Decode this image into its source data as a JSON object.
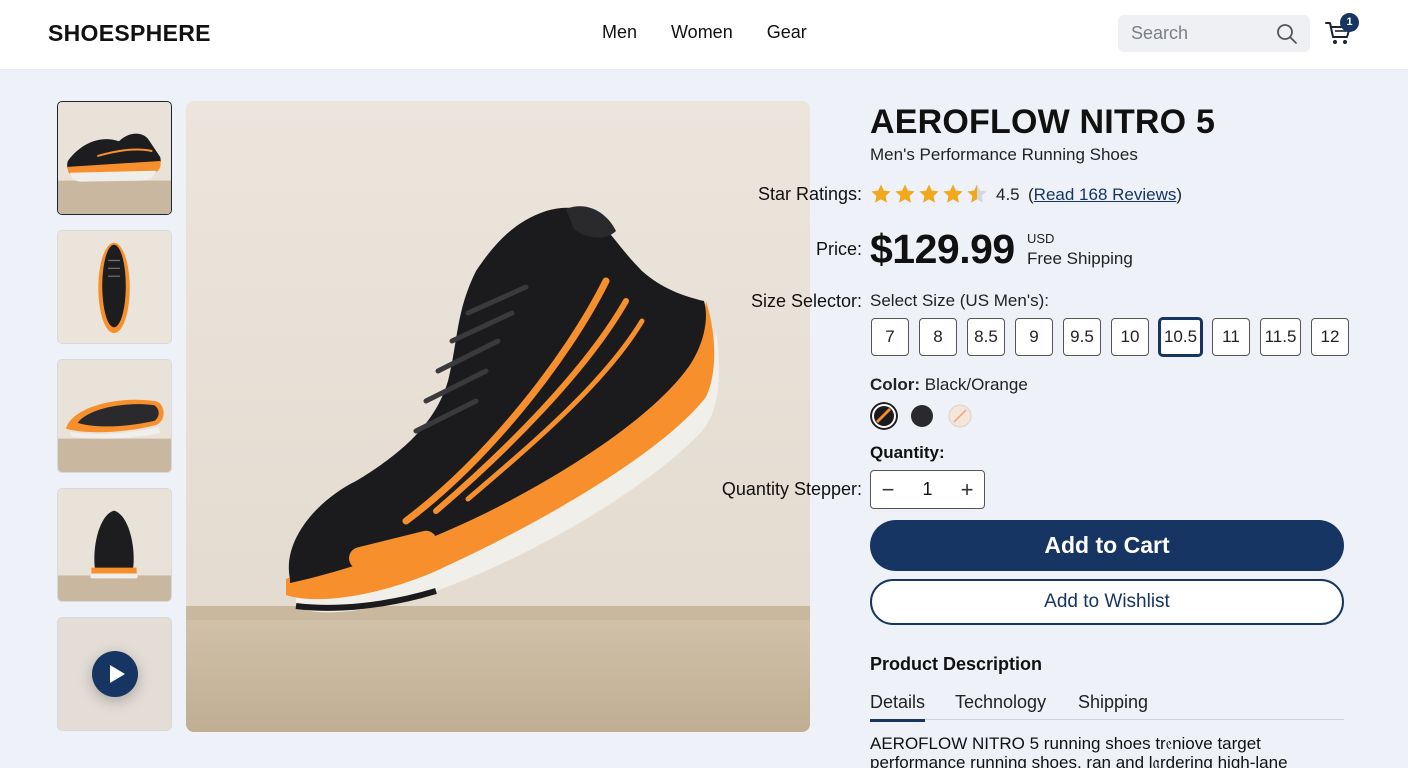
{
  "header": {
    "logo": "SHOESPHERE",
    "nav": [
      "Men",
      "Women",
      "Gear"
    ],
    "search_placeholder": "Search",
    "cart_count": "1"
  },
  "gallery": {
    "thumbnails": [
      "side view",
      "top view",
      "sole view",
      "back view",
      "video"
    ],
    "selected_index": 0
  },
  "product": {
    "title": "AEROFLOW NITRO 5",
    "subtitle": "Men's Performance Running Shoes",
    "labels": {
      "rating": "Star Ratings:",
      "price": "Price:",
      "size": "Size Selector:",
      "quantity_stepper": "Quantity Stepper:"
    },
    "rating": {
      "value": "4.5",
      "stars": 4.5,
      "paren_open": "(",
      "reviews_link": "Read 168 Reviews",
      "paren_close": ")"
    },
    "price": {
      "amount": "$129.99",
      "currency": "USD",
      "shipping": "Free Shipping"
    },
    "size": {
      "heading": "Select Size (US Men's):",
      "options": [
        "7",
        "8",
        "8.5",
        "9",
        "9.5",
        "10",
        "10.5",
        "11",
        "11.5",
        "12"
      ],
      "selected": "10.5"
    },
    "color": {
      "label": "Color:",
      "value": "Black/Orange",
      "swatches": [
        {
          "name": "black-orange",
          "selected": true
        },
        {
          "name": "black",
          "selected": false
        },
        {
          "name": "white-peach",
          "selected": false
        }
      ]
    },
    "quantity": {
      "label": "Quantity:",
      "minus": "−",
      "value": "1",
      "plus": "+"
    },
    "add_to_cart": "Add to Cart",
    "add_to_wishlist": "Add to Wishlist",
    "description": {
      "heading": "Product Description",
      "tabs": [
        "Details",
        "Technology",
        "Shipping"
      ],
      "active_tab": "Details",
      "text": "AEROFLOW NITRO 5 running shoes tr𝔢niove target performance running shoes, ran and l𝔞rdering high-lane"
    }
  },
  "colors": {
    "brand_navy": "#163563",
    "star_gold": "#f2a81d",
    "shoe_orange": "#f7902c",
    "background": "#eef2f8"
  }
}
